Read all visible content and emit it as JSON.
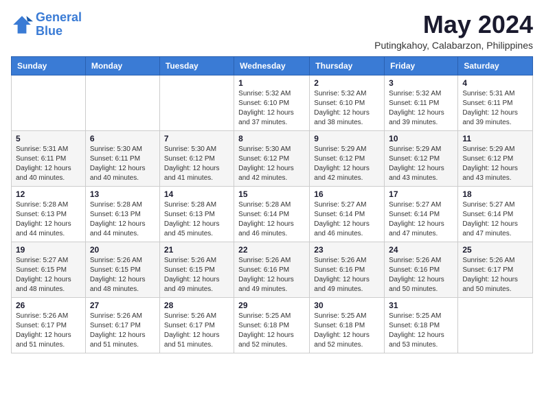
{
  "logo": {
    "line1": "General",
    "line2": "Blue"
  },
  "title": "May 2024",
  "location": "Putingkahoy, Calabarzon, Philippines",
  "days_of_week": [
    "Sunday",
    "Monday",
    "Tuesday",
    "Wednesday",
    "Thursday",
    "Friday",
    "Saturday"
  ],
  "weeks": [
    [
      {
        "day": "",
        "info": ""
      },
      {
        "day": "",
        "info": ""
      },
      {
        "day": "",
        "info": ""
      },
      {
        "day": "1",
        "info": "Sunrise: 5:32 AM\nSunset: 6:10 PM\nDaylight: 12 hours and 37 minutes."
      },
      {
        "day": "2",
        "info": "Sunrise: 5:32 AM\nSunset: 6:10 PM\nDaylight: 12 hours and 38 minutes."
      },
      {
        "day": "3",
        "info": "Sunrise: 5:32 AM\nSunset: 6:11 PM\nDaylight: 12 hours and 39 minutes."
      },
      {
        "day": "4",
        "info": "Sunrise: 5:31 AM\nSunset: 6:11 PM\nDaylight: 12 hours and 39 minutes."
      }
    ],
    [
      {
        "day": "5",
        "info": "Sunrise: 5:31 AM\nSunset: 6:11 PM\nDaylight: 12 hours and 40 minutes."
      },
      {
        "day": "6",
        "info": "Sunrise: 5:30 AM\nSunset: 6:11 PM\nDaylight: 12 hours and 40 minutes."
      },
      {
        "day": "7",
        "info": "Sunrise: 5:30 AM\nSunset: 6:12 PM\nDaylight: 12 hours and 41 minutes."
      },
      {
        "day": "8",
        "info": "Sunrise: 5:30 AM\nSunset: 6:12 PM\nDaylight: 12 hours and 42 minutes."
      },
      {
        "day": "9",
        "info": "Sunrise: 5:29 AM\nSunset: 6:12 PM\nDaylight: 12 hours and 42 minutes."
      },
      {
        "day": "10",
        "info": "Sunrise: 5:29 AM\nSunset: 6:12 PM\nDaylight: 12 hours and 43 minutes."
      },
      {
        "day": "11",
        "info": "Sunrise: 5:29 AM\nSunset: 6:12 PM\nDaylight: 12 hours and 43 minutes."
      }
    ],
    [
      {
        "day": "12",
        "info": "Sunrise: 5:28 AM\nSunset: 6:13 PM\nDaylight: 12 hours and 44 minutes."
      },
      {
        "day": "13",
        "info": "Sunrise: 5:28 AM\nSunset: 6:13 PM\nDaylight: 12 hours and 44 minutes."
      },
      {
        "day": "14",
        "info": "Sunrise: 5:28 AM\nSunset: 6:13 PM\nDaylight: 12 hours and 45 minutes."
      },
      {
        "day": "15",
        "info": "Sunrise: 5:28 AM\nSunset: 6:14 PM\nDaylight: 12 hours and 46 minutes."
      },
      {
        "day": "16",
        "info": "Sunrise: 5:27 AM\nSunset: 6:14 PM\nDaylight: 12 hours and 46 minutes."
      },
      {
        "day": "17",
        "info": "Sunrise: 5:27 AM\nSunset: 6:14 PM\nDaylight: 12 hours and 47 minutes."
      },
      {
        "day": "18",
        "info": "Sunrise: 5:27 AM\nSunset: 6:14 PM\nDaylight: 12 hours and 47 minutes."
      }
    ],
    [
      {
        "day": "19",
        "info": "Sunrise: 5:27 AM\nSunset: 6:15 PM\nDaylight: 12 hours and 48 minutes."
      },
      {
        "day": "20",
        "info": "Sunrise: 5:26 AM\nSunset: 6:15 PM\nDaylight: 12 hours and 48 minutes."
      },
      {
        "day": "21",
        "info": "Sunrise: 5:26 AM\nSunset: 6:15 PM\nDaylight: 12 hours and 49 minutes."
      },
      {
        "day": "22",
        "info": "Sunrise: 5:26 AM\nSunset: 6:16 PM\nDaylight: 12 hours and 49 minutes."
      },
      {
        "day": "23",
        "info": "Sunrise: 5:26 AM\nSunset: 6:16 PM\nDaylight: 12 hours and 49 minutes."
      },
      {
        "day": "24",
        "info": "Sunrise: 5:26 AM\nSunset: 6:16 PM\nDaylight: 12 hours and 50 minutes."
      },
      {
        "day": "25",
        "info": "Sunrise: 5:26 AM\nSunset: 6:17 PM\nDaylight: 12 hours and 50 minutes."
      }
    ],
    [
      {
        "day": "26",
        "info": "Sunrise: 5:26 AM\nSunset: 6:17 PM\nDaylight: 12 hours and 51 minutes."
      },
      {
        "day": "27",
        "info": "Sunrise: 5:26 AM\nSunset: 6:17 PM\nDaylight: 12 hours and 51 minutes."
      },
      {
        "day": "28",
        "info": "Sunrise: 5:26 AM\nSunset: 6:17 PM\nDaylight: 12 hours and 51 minutes."
      },
      {
        "day": "29",
        "info": "Sunrise: 5:25 AM\nSunset: 6:18 PM\nDaylight: 12 hours and 52 minutes."
      },
      {
        "day": "30",
        "info": "Sunrise: 5:25 AM\nSunset: 6:18 PM\nDaylight: 12 hours and 52 minutes."
      },
      {
        "day": "31",
        "info": "Sunrise: 5:25 AM\nSunset: 6:18 PM\nDaylight: 12 hours and 53 minutes."
      },
      {
        "day": "",
        "info": ""
      }
    ]
  ]
}
